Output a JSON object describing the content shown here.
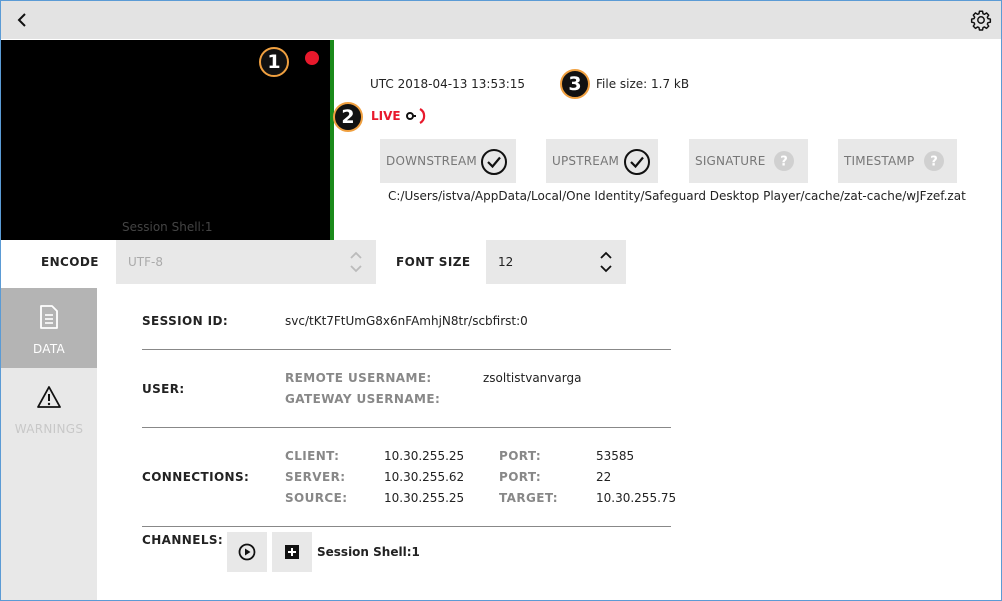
{
  "header": {
    "back_icon": "chevron-left-icon",
    "settings_icon": "gear-icon"
  },
  "player": {
    "video_label": "Session Shell:1",
    "rec_color": "#e8192c",
    "badges": [
      "1",
      "2",
      "3"
    ],
    "utc": "UTC 2018-04-13 13:53:15",
    "file_size": "File size: 1.7 kB",
    "live_label": "LIVE",
    "status_buttons": [
      {
        "label": "DOWNSTREAM",
        "icon": "check-circle-icon"
      },
      {
        "label": "UPSTREAM",
        "icon": "check-circle-icon"
      },
      {
        "label": "SIGNATURE",
        "icon": "question-circle-icon"
      },
      {
        "label": "TIMESTAMP",
        "icon": "question-circle-icon"
      }
    ],
    "path": "C:/Users/istva/AppData/Local/One Identity/Safeguard Desktop Player/cache/zat-cache/wJFzef.zat"
  },
  "encoding": {
    "encode_label": "ENCODE",
    "encode_value": "UTF-8",
    "font_size_label": "FONT SIZE",
    "font_size_value": "12"
  },
  "sidebar": {
    "items": [
      {
        "label": "DATA",
        "icon": "document-icon",
        "active": true
      },
      {
        "label": "WARNINGS",
        "icon": "warning-icon",
        "active": false
      }
    ]
  },
  "details": {
    "session_id_label": "SESSION ID:",
    "session_id": "svc/tKt7FtUmG8x6nFAmhjN8tr/scbfirst:0",
    "user_label": "USER:",
    "remote_username_label": "REMOTE USERNAME:",
    "remote_username": "zsoltistvanvarga",
    "gateway_username_label": "GATEWAY USERNAME:",
    "connections_label": "CONNECTIONS:",
    "client_label": "CLIENT:",
    "client": "10.30.255.25",
    "server_label": "SERVER:",
    "server": "10.30.255.62",
    "source_label": "SOURCE:",
    "source": "10.30.255.25",
    "port1_label": "PORT:",
    "port1": "53585",
    "port2_label": "PORT:",
    "port2": "22",
    "target_label": "TARGET:",
    "target": "10.30.255.75",
    "channels_label": "CHANNELS:",
    "channel_name": "Session Shell:1"
  }
}
